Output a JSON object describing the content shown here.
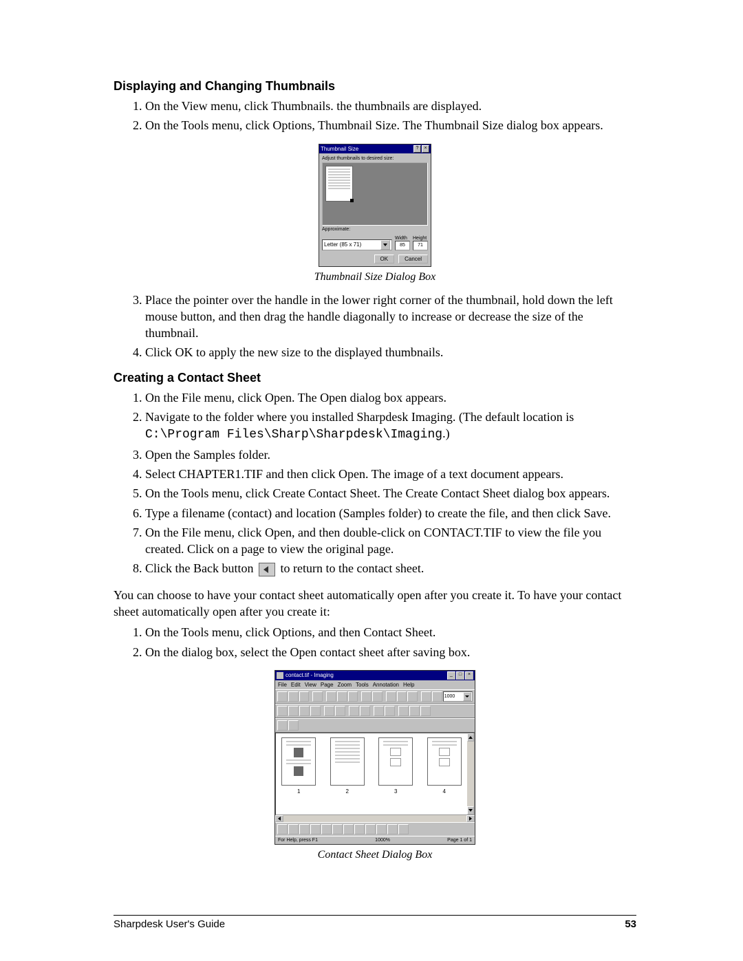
{
  "section1": {
    "heading": "Displaying and Changing Thumbnails",
    "step1": "On the View menu, click Thumbnails. the thumbnails are displayed.",
    "step2": "On the Tools menu, click Options, Thumbnail Size. The Thumbnail Size dialog box appears.",
    "caption1": "Thumbnail Size Dialog Box",
    "step3": "Place the pointer over the handle in the lower right corner of the thumbnail, hold down the left mouse button, and then drag the handle diagonally to increase or decrease the size of the thumbnail.",
    "step4": "Click OK to apply the new size to the displayed thumbnails."
  },
  "dialog1": {
    "title": "Thumbnail Size",
    "label_top": "Adjust thumbnails to desired size:",
    "approx_label": "Approximate:",
    "select_value": "Letter (85 x 71)",
    "width_label": "Width",
    "height_label": "Height",
    "width_value": "85",
    "height_value": "71",
    "ok": "OK",
    "cancel": "Cancel"
  },
  "section2": {
    "heading": "Creating a Contact Sheet",
    "step1": "On the File menu, click Open. The Open dialog box appears.",
    "step2a": "Navigate to the folder where you installed Sharpdesk Imaging. (The default location is ",
    "step2b": "C:\\Program Files\\Sharp\\Sharpdesk\\Imaging",
    "step2c": ".)",
    "step3": "Open the Samples folder.",
    "step4": "Select CHAPTER1.TIF and then click Open. The image of a text document appears.",
    "step5": "On the Tools menu, click Create Contact Sheet. The Create Contact Sheet dialog box appears.",
    "step6": "Type a filename (contact) and location (Samples folder) to create the file, and then click Save.",
    "step7": "On the File menu, click Open, and then double-click on CONTACT.TIF to view the file you created. Click on a page to view the original page.",
    "step8a": "Click the Back button ",
    "step8b": " to return to the contact sheet.",
    "para": "You can choose to have your contact sheet automatically open after you create it. To have your contact sheet automatically open after you create it:",
    "step9": "On the Tools menu, click Options, and then Contact Sheet.",
    "step10": "On the dialog box, select the Open contact sheet after saving box.",
    "caption2": "Contact Sheet Dialog Box"
  },
  "window2": {
    "title": "contact.tif - Imaging",
    "menu": [
      "File",
      "Edit",
      "View",
      "Page",
      "Zoom",
      "Tools",
      "Annotation",
      "Help"
    ],
    "zoom": "1000",
    "cells": [
      "1",
      "2",
      "3",
      "4"
    ],
    "status_left": "For Help, press F1",
    "status_mid": "1000%",
    "status_right": "Page 1 of 1"
  },
  "footer": {
    "left": "Sharpdesk User's Guide",
    "right": "53"
  }
}
